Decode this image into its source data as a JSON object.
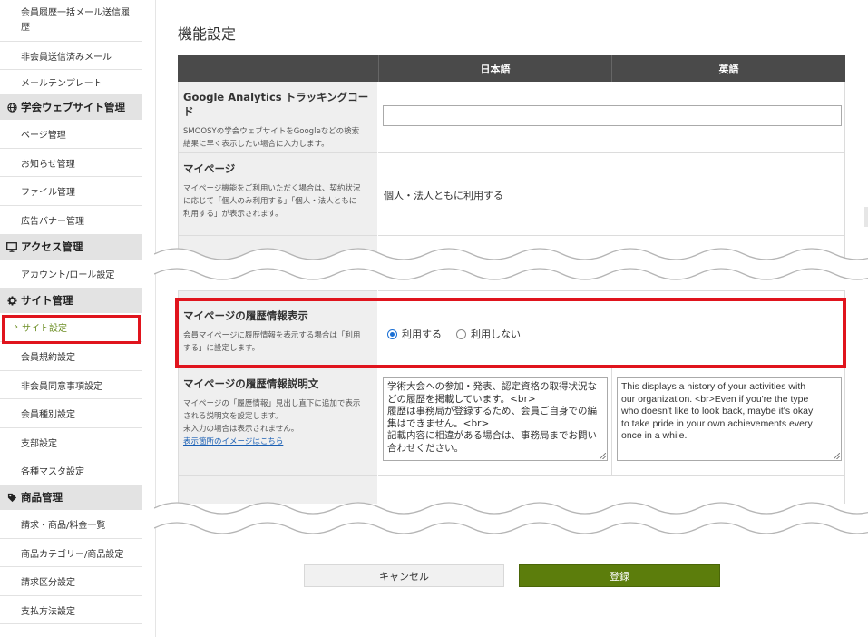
{
  "sidebar": {
    "items_top": [
      {
        "label": "会員履歴一括メール送信履",
        "label2": "歴"
      },
      {
        "label": "非会員送信済みメール"
      },
      {
        "label": "メールテンプレート"
      }
    ],
    "section_website": {
      "title": "学会ウェブサイト管理",
      "icon": "globe-icon"
    },
    "items_website": [
      {
        "label": "ページ管理"
      },
      {
        "label": "お知らせ管理"
      },
      {
        "label": "ファイル管理"
      },
      {
        "label": "広告バナー管理"
      }
    ],
    "section_access": {
      "title": "アクセス管理",
      "icon": "monitor-icon"
    },
    "items_access": [
      {
        "label": "アカウント/ロール設定"
      }
    ],
    "section_site": {
      "title": "サイト管理",
      "icon": "gear-icon"
    },
    "items_site": [
      {
        "label": "サイト設定",
        "active": true
      },
      {
        "label": "会員規約設定"
      },
      {
        "label": "非会員同意事項設定"
      },
      {
        "label": "会員種別設定"
      },
      {
        "label": "支部設定"
      },
      {
        "label": "各種マスタ設定"
      }
    ],
    "section_product": {
      "title": "商品管理",
      "icon": "tag-icon"
    },
    "items_product": [
      {
        "label": "請求・商品/料金一覧"
      },
      {
        "label": "商品カテゴリー/商品設定"
      },
      {
        "label": "請求区分設定"
      },
      {
        "label": "支払方法設定"
      }
    ]
  },
  "main": {
    "title": "機能設定",
    "columns": {
      "japanese": "日本語",
      "english": "英語"
    },
    "rows": {
      "ga": {
        "title": "Google Analytics トラッキングコード",
        "desc1": "SMOOSYの学会ウェブサイトをGoogleなどの検索",
        "desc2": "結果に早く表示したい場合に入力します。",
        "value": ""
      },
      "mypage": {
        "title": "マイページ",
        "desc1": "マイページ機能をご利用いただく場合は、契約状況",
        "desc2": "に応じて「個人のみ利用する」「個人・法人ともに",
        "desc3": "利用する」が表示されます。",
        "value": "個人・法人ともに利用する"
      },
      "history": {
        "title": "マイページの履歴情報表示",
        "desc1": "会員マイページに履歴情報を表示する場合は「利用",
        "desc2": "する」に設定します。",
        "options": [
          "利用する",
          "利用しない"
        ],
        "selected": "利用する"
      },
      "history_desc": {
        "title": "マイページの履歴情報説明文",
        "desc1": "マイページの「履歴情報」見出し直下に追加で表示",
        "desc2": "される説明文を設定します。",
        "desc3": "未入力の場合は表示されません。",
        "link": "表示箇所のイメージはこちら",
        "ja_lines": [
          "学術大会への参加・発表、認定資格の取得状況な",
          "どの履歴を掲載しています。<br>",
          "履歴は事務局が登録するため、会員ご自身での編",
          "集はできません。<br>",
          "記載内容に相違がある場合は、事務局までお問い",
          "合わせください。"
        ],
        "en_lines": [
          "This displays a history of your activities with",
          "our organization. <br>Even if you're the type",
          "who doesn't like to look back, maybe it's okay",
          "to take pride in your own achievements every",
          "once in a while."
        ]
      }
    },
    "buttons": {
      "cancel": "キャンセル",
      "submit": "登録"
    }
  }
}
